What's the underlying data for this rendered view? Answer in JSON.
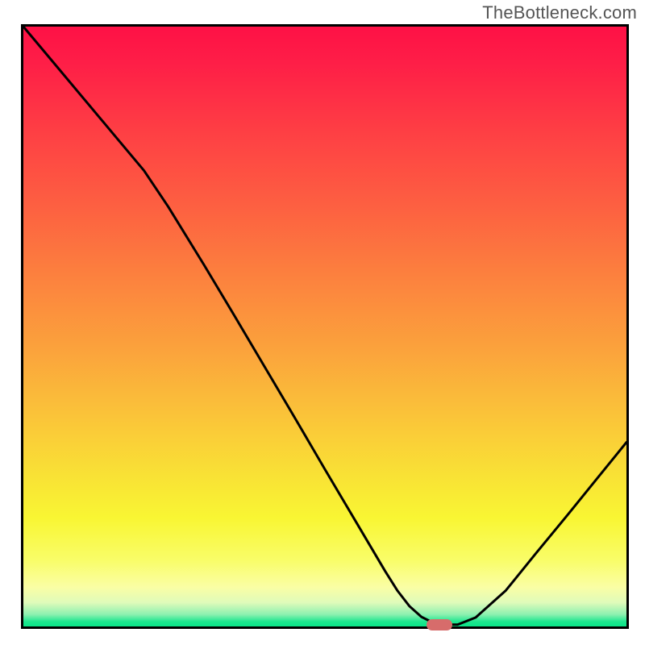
{
  "watermark": "TheBottleneck.com",
  "chart_data": {
    "type": "line",
    "title": "",
    "xlabel": "",
    "ylabel": "",
    "xlim": [
      0,
      100
    ],
    "ylim": [
      0,
      100
    ],
    "x": [
      0,
      5,
      10,
      15,
      20,
      24,
      30,
      35,
      40,
      45,
      50,
      55,
      60,
      62,
      64,
      66,
      68,
      70,
      72,
      75,
      80,
      85,
      90,
      95,
      100
    ],
    "values": [
      100,
      94,
      88,
      82,
      76,
      70,
      60.2,
      51.8,
      43.3,
      34.8,
      26.2,
      17.7,
      9.2,
      6.0,
      3.4,
      1.6,
      0.6,
      0.3,
      0.3,
      1.5,
      6.0,
      12.2,
      18.3,
      24.5,
      30.7
    ],
    "grid": false,
    "legend": false,
    "marker": {
      "x": 69,
      "y": 0.3,
      "color": "#d76c6b"
    },
    "gradient_stops": [
      {
        "pos": 0.0,
        "color": "#fe1146"
      },
      {
        "pos": 0.3,
        "color": "#fd6041"
      },
      {
        "pos": 0.6,
        "color": "#fab83a"
      },
      {
        "pos": 0.82,
        "color": "#f9f633"
      },
      {
        "pos": 0.95,
        "color": "#d9fcb3"
      },
      {
        "pos": 1.0,
        "color": "#0ae588"
      }
    ]
  }
}
